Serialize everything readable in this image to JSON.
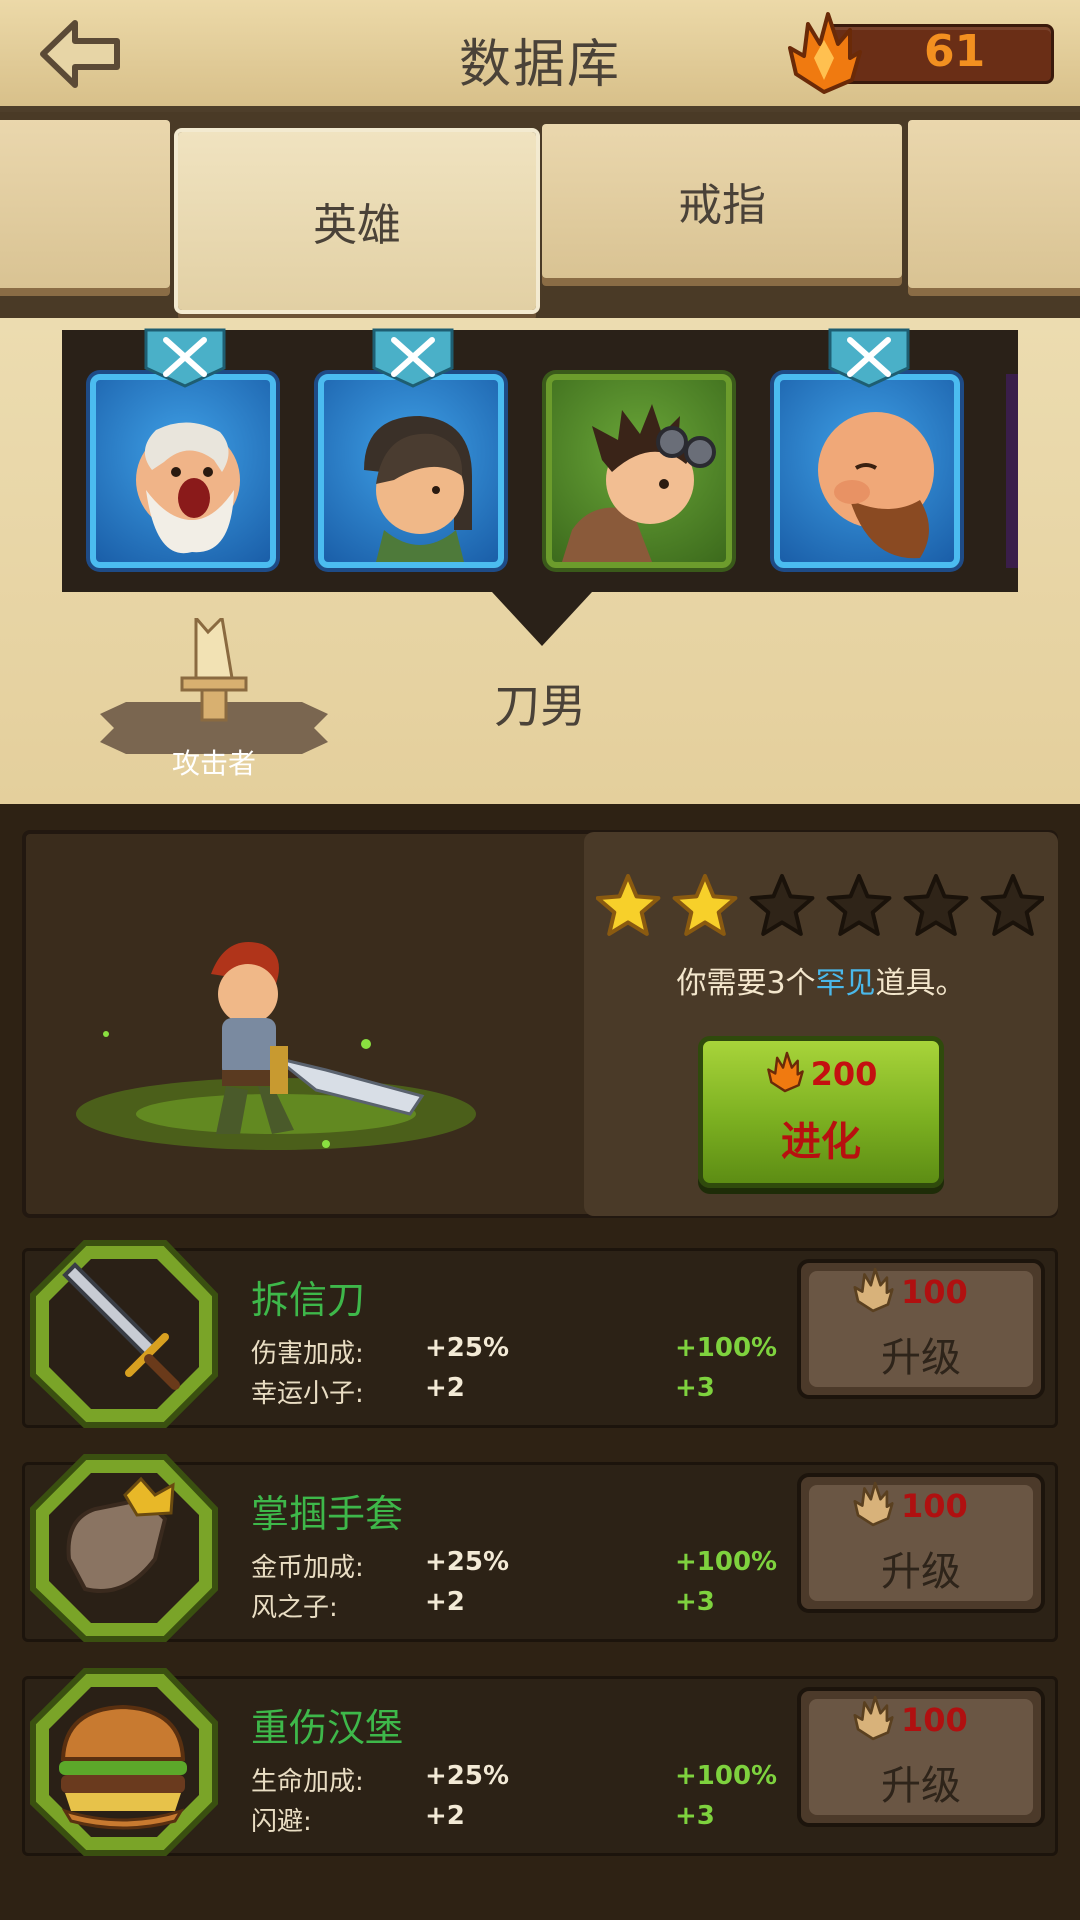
{
  "header": {
    "title": "数据库",
    "gems": "61"
  },
  "tabs": [
    {
      "label": ""
    },
    {
      "label": "英雄"
    },
    {
      "label": "戒指"
    },
    {
      "label": ""
    }
  ],
  "hero": {
    "name": "刀男",
    "role": "攻击者"
  },
  "evolve": {
    "stars_filled": 2,
    "stars_total": 6,
    "need_prefix": "你需要3个",
    "need_rare": "罕见",
    "need_suffix": "道具。",
    "cost": "200",
    "label": "进化"
  },
  "items": [
    {
      "name": "拆信刀",
      "stat1_label": "伤害加成:",
      "stat1_val": "+25%",
      "stat1_max": "+100%",
      "stat2_label": "幸运小子:",
      "stat2_val": "+2",
      "stat2_max": "+3",
      "cost": "100",
      "button": "升级",
      "icon": "sword-icon"
    },
    {
      "name": "掌掴手套",
      "stat1_label": "金币加成:",
      "stat1_val": "+25%",
      "stat1_max": "+100%",
      "stat2_label": "风之子:",
      "stat2_val": "+2",
      "stat2_max": "+3",
      "cost": "100",
      "button": "升级",
      "icon": "glove-icon"
    },
    {
      "name": "重伤汉堡",
      "stat1_label": "生命加成:",
      "stat1_val": "+25%",
      "stat1_max": "+100%",
      "stat2_label": "闪避:",
      "stat2_val": "+2",
      "stat2_max": "+3",
      "cost": "100",
      "button": "升级",
      "icon": "burger-icon"
    }
  ]
}
